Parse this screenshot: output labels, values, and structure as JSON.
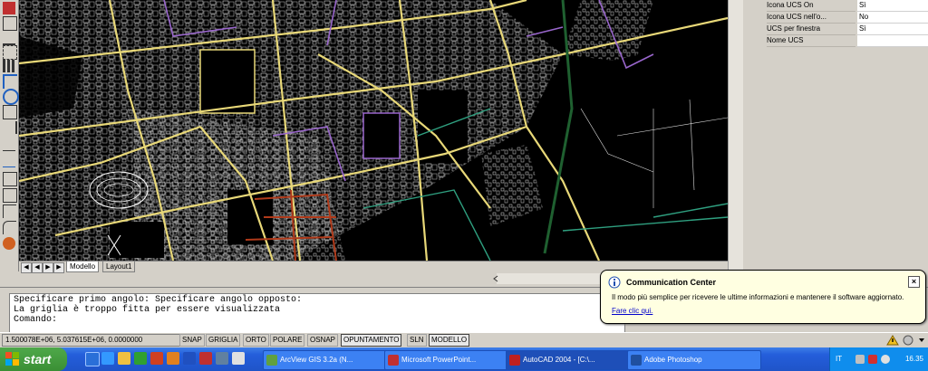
{
  "layout_tabs": {
    "model": "Modello",
    "layout1": "Layout1"
  },
  "properties": [
    {
      "name": "Icona UCS On",
      "value": "Sì"
    },
    {
      "name": "Icona UCS nell'o...",
      "value": "No"
    },
    {
      "name": "UCS per finestra",
      "value": "Sì"
    },
    {
      "name": "Nome UCS",
      "value": ""
    }
  ],
  "command": {
    "line1": "Specificare primo angolo: Specificare angolo opposto:",
    "line2": "La griglia è troppo fitta per essere visualizzata",
    "line3": "Comando:"
  },
  "status": {
    "coords": "1.500078E+06, 5.037615E+06, 0.0000000",
    "buttons": [
      "SNAP",
      "GRIGLIA",
      "ORTO",
      "POLARE",
      "OSNAP",
      "OPUNTAMENTO",
      "SLN",
      "MODELLO"
    ]
  },
  "notification": {
    "title": "Communication Center",
    "message": "Il modo più semplice per ricevere le ultime informazioni e mantenere il software aggiornato.",
    "link": "Fare clic qui."
  },
  "taskbar": {
    "start": "start",
    "tasks": [
      "ArcView GIS 3.2a (N...",
      "Microsoft PowerPoint...",
      "AutoCAD 2004 - [C:\\...",
      "Adobe Photoshop"
    ],
    "lang": "IT",
    "clock": "16.35"
  },
  "colors": {
    "canvas": "#000000",
    "road_yellow": "#e8d878",
    "boundary_purple": "#9966cc",
    "highlight_red": "#b03a1a"
  }
}
